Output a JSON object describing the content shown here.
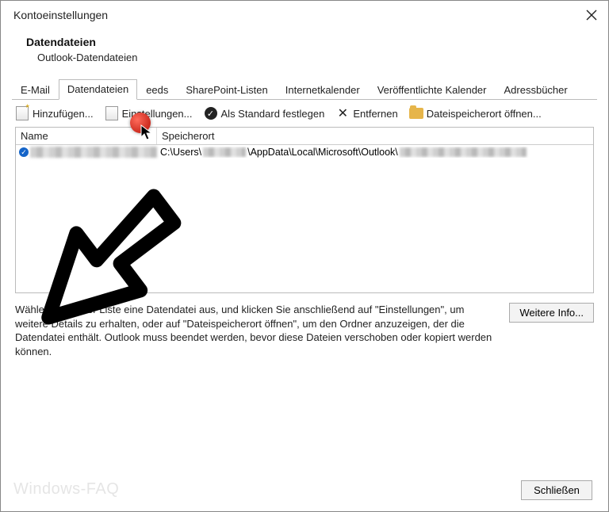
{
  "window": {
    "title": "Kontoeinstellungen"
  },
  "header": {
    "title": "Datendateien",
    "subtitle": "Outlook-Datendateien"
  },
  "tabs": {
    "email": "E-Mail",
    "datafiles": "Datendateien",
    "feeds": "eeds",
    "sharepoint": "SharePoint-Listen",
    "ical": "Internetkalender",
    "pubcal": "Veröffentlichte Kalender",
    "addr": "Adressbücher"
  },
  "toolbar": {
    "add": "Hinzufügen...",
    "settings": "Einstellungen...",
    "setdefault": "Als Standard festlegen",
    "remove": "Entfernen",
    "openloc": "Dateispeicherort öffnen..."
  },
  "columns": {
    "name": "Name",
    "location": "Speicherort"
  },
  "row": {
    "loc_prefix": "C:\\Users\\",
    "loc_mid": "\\AppData\\Local\\Microsoft\\Outlook\\"
  },
  "hint": "Wählen Sie in der Liste eine Datendatei aus, und klicken Sie anschließend auf \"Einstellungen\", um weitere Details zu erhalten, oder auf \"Dateispeicherort öffnen\", um den Ordner anzuzeigen, der die Datendatei enthält. Outlook muss beendet werden, bevor diese Dateien verschoben oder kopiert werden können.",
  "buttons": {
    "moreinfo": "Weitere Info...",
    "close": "Schließen"
  },
  "watermark": "Windows-FAQ"
}
